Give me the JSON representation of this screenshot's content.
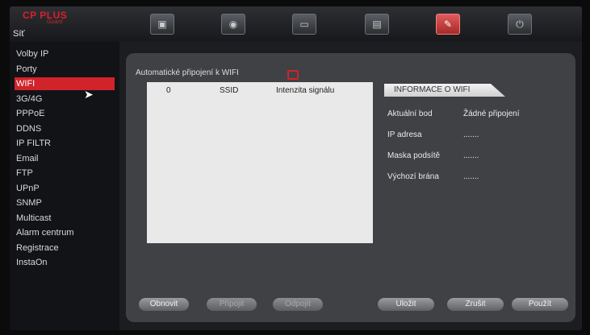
{
  "header": {
    "logo_text": "CP PLUS",
    "logo_sub": "Guard",
    "section_title": "Síť",
    "tabs": [
      {
        "icon": "monitor-icon"
      },
      {
        "icon": "camera-icon"
      },
      {
        "icon": "display-icon"
      },
      {
        "icon": "storage-icon"
      },
      {
        "icon": "wrench-icon",
        "active": true
      },
      {
        "icon": "power-icon"
      }
    ]
  },
  "sidebar": {
    "items": [
      {
        "label": "Volby IP"
      },
      {
        "label": "Porty"
      },
      {
        "label": "WIFI",
        "active": true
      },
      {
        "label": "3G/4G"
      },
      {
        "label": "PPPoE"
      },
      {
        "label": "DDNS"
      },
      {
        "label": "IP FILTR"
      },
      {
        "label": "Email"
      },
      {
        "label": "FTP"
      },
      {
        "label": "UPnP"
      },
      {
        "label": "SNMP"
      },
      {
        "label": "Multicast"
      },
      {
        "label": "Alarm centrum"
      },
      {
        "label": "Registrace"
      },
      {
        "label": "InstaOn"
      }
    ]
  },
  "wifi": {
    "auto_connect_label": "Automatické připojení k WIFI",
    "auto_connect_checked": false,
    "table": {
      "columns": [
        "0",
        "SSID",
        "Intenzita signálu"
      ]
    },
    "info": {
      "title": "INFORMACE O WIFI",
      "rows": [
        {
          "label": "Aktuální bod",
          "value": "Žádné připojení"
        },
        {
          "label": "IP adresa",
          "value": "......."
        },
        {
          "label": "Maska podsítě",
          "value": "......."
        },
        {
          "label": "Výchozí brána",
          "value": "......."
        }
      ]
    }
  },
  "footer": {
    "refresh": "Obnovit",
    "connect": "Připojit",
    "disconnect": "Odpojit",
    "save": "Uložit",
    "cancel": "Zrušit",
    "apply": "Použít"
  },
  "colors": {
    "accent": "#d0232a",
    "panel": "#3f4145",
    "sidebar": "#121316"
  }
}
